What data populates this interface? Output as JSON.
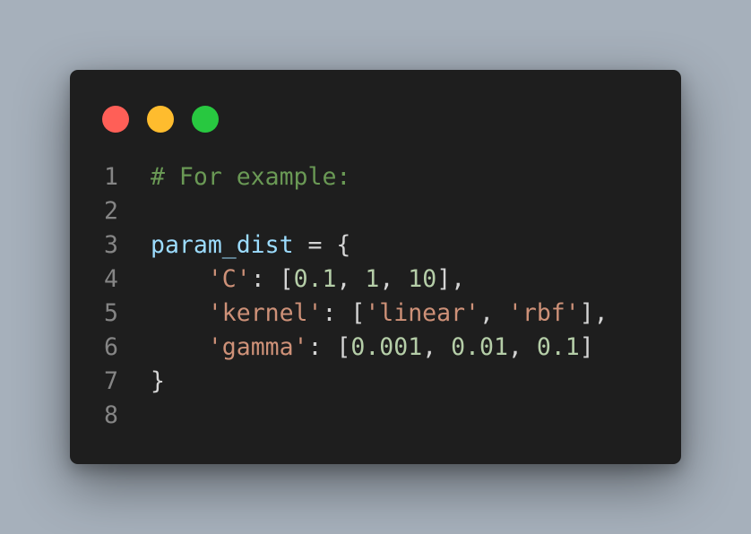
{
  "window": {
    "buttons": [
      {
        "name": "close",
        "color": "#ff5f57"
      },
      {
        "name": "minimize",
        "color": "#febc2e"
      },
      {
        "name": "zoom",
        "color": "#28c840"
      }
    ]
  },
  "theme": {
    "comment": "#6a9955",
    "variable": "#9cdcfe",
    "string": "#ce9178",
    "number": "#b5cea8",
    "punctuation": "#d4d4d4"
  },
  "code": {
    "lines": [
      {
        "number": "1",
        "tokens": [
          {
            "text": "# For example:",
            "kind": "comment"
          }
        ]
      },
      {
        "number": "2",
        "tokens": []
      },
      {
        "number": "3",
        "tokens": [
          {
            "text": "param_dist",
            "kind": "variable"
          },
          {
            "text": " = {",
            "kind": "punctuation"
          }
        ]
      },
      {
        "number": "4",
        "tokens": [
          {
            "text": "    ",
            "kind": "punctuation"
          },
          {
            "text": "'C'",
            "kind": "string"
          },
          {
            "text": ": [",
            "kind": "punctuation"
          },
          {
            "text": "0.1",
            "kind": "number"
          },
          {
            "text": ", ",
            "kind": "punctuation"
          },
          {
            "text": "1",
            "kind": "number"
          },
          {
            "text": ", ",
            "kind": "punctuation"
          },
          {
            "text": "10",
            "kind": "number"
          },
          {
            "text": "],",
            "kind": "punctuation"
          }
        ]
      },
      {
        "number": "5",
        "tokens": [
          {
            "text": "    ",
            "kind": "punctuation"
          },
          {
            "text": "'kernel'",
            "kind": "string"
          },
          {
            "text": ": [",
            "kind": "punctuation"
          },
          {
            "text": "'linear'",
            "kind": "string"
          },
          {
            "text": ", ",
            "kind": "punctuation"
          },
          {
            "text": "'rbf'",
            "kind": "string"
          },
          {
            "text": "],",
            "kind": "punctuation"
          }
        ]
      },
      {
        "number": "6",
        "tokens": [
          {
            "text": "    ",
            "kind": "punctuation"
          },
          {
            "text": "'gamma'",
            "kind": "string"
          },
          {
            "text": ": [",
            "kind": "punctuation"
          },
          {
            "text": "0.001",
            "kind": "number"
          },
          {
            "text": ", ",
            "kind": "punctuation"
          },
          {
            "text": "0.01",
            "kind": "number"
          },
          {
            "text": ", ",
            "kind": "punctuation"
          },
          {
            "text": "0.1",
            "kind": "number"
          },
          {
            "text": "]",
            "kind": "punctuation"
          }
        ]
      },
      {
        "number": "7",
        "tokens": [
          {
            "text": "}",
            "kind": "punctuation"
          }
        ]
      },
      {
        "number": "8",
        "tokens": []
      }
    ]
  }
}
